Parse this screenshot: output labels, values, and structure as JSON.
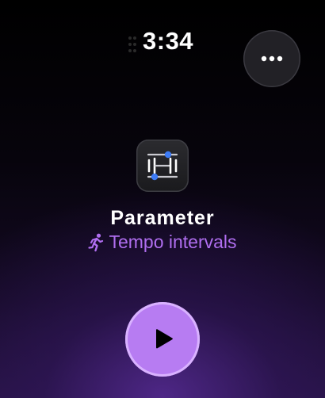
{
  "status": {
    "time": "3:34"
  },
  "toolbar": {
    "more_icon": "ellipsis-icon"
  },
  "workout": {
    "icon": "parameter-sliders-icon",
    "title": "Parameter",
    "activity_icon": "running-figure-icon",
    "subtitle": "Tempo intervals"
  },
  "controls": {
    "play_icon": "play-icon"
  },
  "colors": {
    "accent": "#b06ef0",
    "play_button": "#b77cf2",
    "slider_knob": "#3d7bf5"
  }
}
